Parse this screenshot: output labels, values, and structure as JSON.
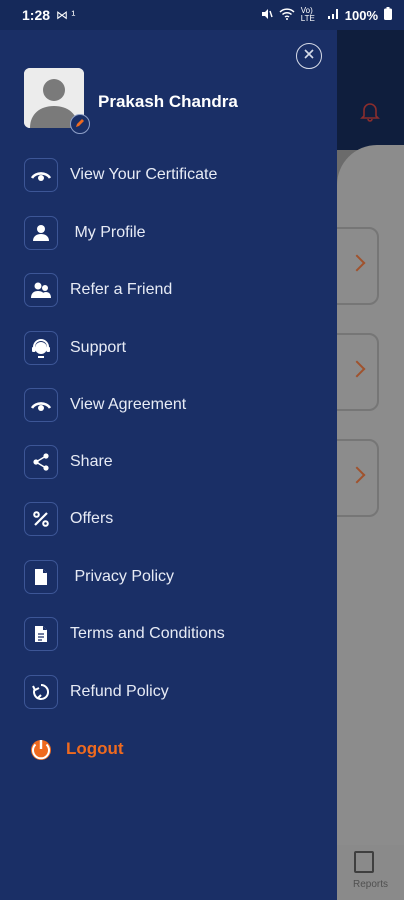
{
  "status_bar": {
    "time": "1:28",
    "left_icons": "⋈ ¹",
    "network": "Vo) LTE",
    "battery": "100%"
  },
  "drawer": {
    "user_name": "Prakash Chandra",
    "menu": [
      {
        "label": "View Your Certificate",
        "icon": "eye-icon"
      },
      {
        "label": " My Profile",
        "icon": "person-icon"
      },
      {
        "label": "Refer a Friend",
        "icon": "people-icon"
      },
      {
        "label": "Support",
        "icon": "headset-icon"
      },
      {
        "label": "View Agreement",
        "icon": "eye-icon"
      },
      {
        "label": "Share",
        "icon": "share-icon"
      },
      {
        "label": "Offers",
        "icon": "percent-icon"
      },
      {
        "label": " Privacy Policy",
        "icon": "document-icon"
      },
      {
        "label": "Terms and Conditions",
        "icon": "document-lines-icon"
      },
      {
        "label": "Refund Policy",
        "icon": "refund-icon"
      }
    ],
    "logout_label": "Logout"
  },
  "background_app": {
    "reports_label": "Reports"
  },
  "colors": {
    "drawer_bg": "#1a2f66",
    "accent": "#ef6a1f",
    "text": "#e7ebf5"
  }
}
